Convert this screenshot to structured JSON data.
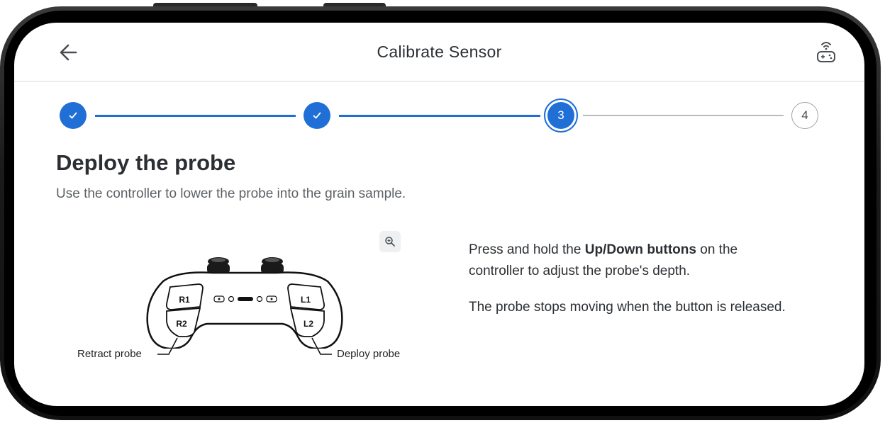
{
  "header": {
    "title": "Calibrate Sensor",
    "back_icon": "arrow-left-icon",
    "remote_icon": "wireless-controller-icon"
  },
  "stepper": {
    "steps": [
      {
        "label": "1",
        "state": "complete"
      },
      {
        "label": "2",
        "state": "complete"
      },
      {
        "label": "3",
        "state": "current"
      },
      {
        "label": "4",
        "state": "upcoming"
      }
    ],
    "accent_color": "#1f6fd6"
  },
  "content": {
    "heading": "Deploy the probe",
    "subtitle": "Use the controller to lower the probe into the grain sample.",
    "diagram": {
      "left_caption": "Retract probe",
      "right_caption": "Deploy probe",
      "labels": {
        "r1": "R1",
        "r2": "R2",
        "l1": "L1",
        "l2": "L2"
      }
    },
    "instruction_1": {
      "before": "Press and hold the ",
      "bold": "Up/Down buttons",
      "after": " on the",
      "line2": "controller to adjust the probe's depth."
    },
    "instruction_2": "The probe stops moving when the button is released."
  }
}
